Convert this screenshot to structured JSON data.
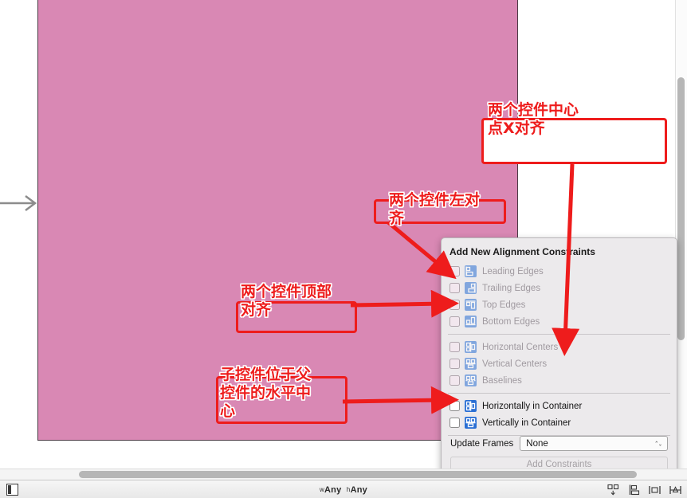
{
  "canvas": {
    "view_color": "#d988b4",
    "entry_arrow_icon": "entry-point-arrow"
  },
  "popover": {
    "title": "Add New Alignment Constraints",
    "rows": [
      {
        "label": "Leading Edges",
        "icon": "align-leading-edges-icon",
        "enabled": false,
        "checked": false,
        "value": ""
      },
      {
        "label": "Trailing Edges",
        "icon": "align-trailing-edges-icon",
        "enabled": false,
        "checked": false,
        "value": ""
      },
      {
        "label": "Top Edges",
        "icon": "align-top-edges-icon",
        "enabled": false,
        "checked": false,
        "value": ""
      },
      {
        "label": "Bottom Edges",
        "icon": "align-bottom-edges-icon",
        "enabled": false,
        "checked": false,
        "value": ""
      },
      {
        "label": "Horizontal Centers",
        "icon": "align-horizontal-centers-icon",
        "enabled": false,
        "checked": false,
        "value": ""
      },
      {
        "label": "Vertical Centers",
        "icon": "align-vertical-centers-icon",
        "enabled": false,
        "checked": false,
        "value": ""
      },
      {
        "label": "Baselines",
        "icon": "align-baselines-icon",
        "enabled": false,
        "checked": false,
        "value": ""
      },
      {
        "label": "Horizontally in Container",
        "icon": "center-horizontally-icon",
        "enabled": true,
        "checked": false,
        "value": ""
      },
      {
        "label": "Vertically in Container",
        "icon": "center-vertically-icon",
        "enabled": true,
        "checked": false,
        "value": ""
      }
    ],
    "update_frames_label": "Update Frames",
    "update_frames_value": "None",
    "add_constraints_label": "Add Constraints"
  },
  "status_bar": {
    "width_class_prefix": "w",
    "width_class_value": "Any",
    "height_class_prefix": "h",
    "height_class_value": "Any",
    "left_icon": "view-as-device-icon",
    "tools": [
      {
        "name": "stack-tool-icon"
      },
      {
        "name": "align-tool-icon"
      },
      {
        "name": "pin-tool-icon"
      },
      {
        "name": "resolve-issues-icon"
      }
    ]
  },
  "annotations": [
    {
      "id": "center-x",
      "text": "两个控件中心\n点X对齐",
      "color": "#ee1c1c"
    },
    {
      "id": "leading",
      "text": "两个控件左对\n齐",
      "color": "#ee1c1c"
    },
    {
      "id": "top",
      "text": "两个控件顶部\n对齐",
      "color": "#ee1c1c"
    },
    {
      "id": "container",
      "text": "子控件位于父\n控件的水平中\n心",
      "color": "#ee1c1c"
    }
  ]
}
